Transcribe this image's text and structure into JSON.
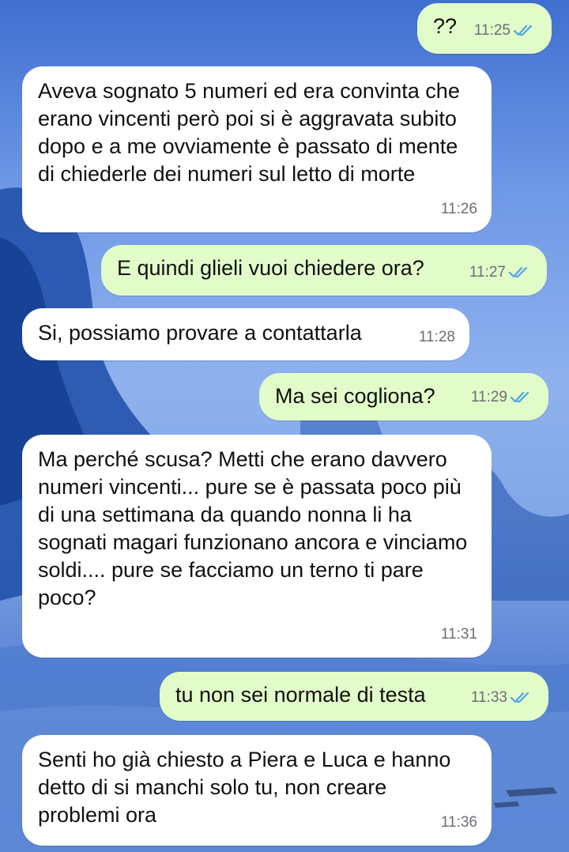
{
  "colors": {
    "outgoing_bubble": "#e2fcc9",
    "incoming_bubble": "#ffffff",
    "read_receipt": "#4fa3e8",
    "timestamp": "#6a6f74"
  },
  "messages": [
    {
      "direction": "out",
      "text": "??",
      "time": "11:25",
      "read_icon": "double-check-icon"
    },
    {
      "direction": "in",
      "text": "Aveva sognato 5 numeri ed era convinta che erano vincenti però poi si è aggravata subito dopo e a me ovviamente è passato di mente di chiederle dei numeri sul letto di morte",
      "time": "11:26"
    },
    {
      "direction": "out",
      "text": "E quindi glieli vuoi chiedere ora?",
      "time": "11:27",
      "read_icon": "double-check-icon"
    },
    {
      "direction": "in",
      "text": "Si, possiamo provare a contattarla",
      "time": "11:28"
    },
    {
      "direction": "out",
      "text": "Ma sei cogliona?",
      "time": "11:29",
      "read_icon": "double-check-icon"
    },
    {
      "direction": "in",
      "text": "Ma perché scusa? Metti che erano davvero numeri vincenti... pure se è passata poco più di una settimana da quando nonna li ha sognati magari funzionano ancora e vinciamo soldi.... pure se facciamo un terno ti pare poco?",
      "time": "11:31"
    },
    {
      "direction": "out",
      "text": "tu non sei normale di testa",
      "time": "11:33",
      "read_icon": "double-check-icon"
    },
    {
      "direction": "in",
      "text": "Senti ho già chiesto a Piera e Luca e hanno detto di si manchi solo tu, non creare problemi ora",
      "time": "11:36"
    }
  ]
}
